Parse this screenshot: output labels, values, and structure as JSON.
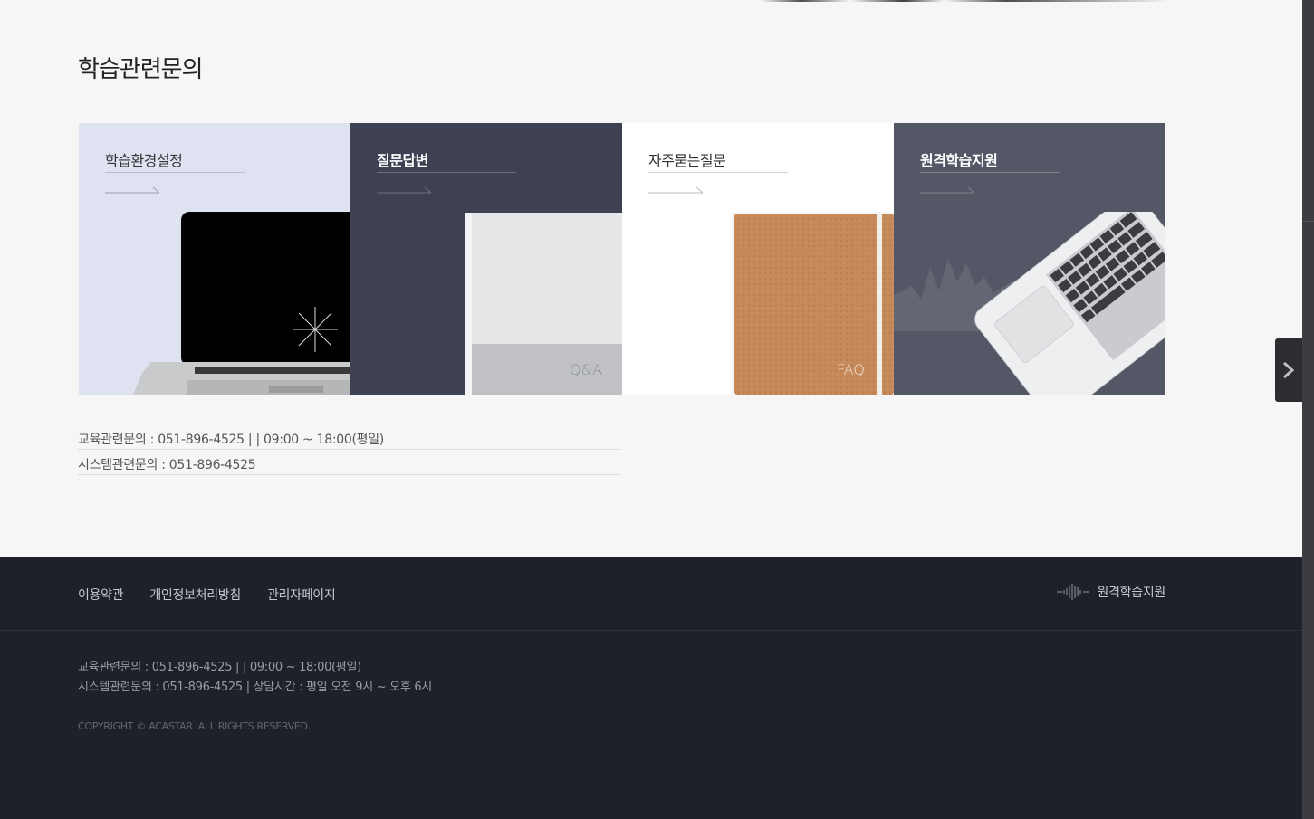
{
  "page": {
    "title": "학습관련문의"
  },
  "cards": [
    {
      "title": "학습환경설정",
      "image": "laptop-image"
    },
    {
      "title": "질문답변",
      "image": "book-image",
      "image_label": "Q&A"
    },
    {
      "title": "자주묻는질문",
      "image": "notebook-image",
      "image_label": "FAQ"
    },
    {
      "title": "원격학습지원",
      "image": "laptop-keyboard-image"
    }
  ],
  "contact": {
    "edu": "교육관련문의 : 051-896-4525  |    |  09:00 ~ 18:00(평일)",
    "system": "시스템관련문의 : 051-896-4525"
  },
  "footer": {
    "nav": [
      "이용약관",
      "개인정보처리방침",
      "관리자페이지"
    ],
    "logo_text": "원격학습지원",
    "info_edu": "교육관련문의 : 051-896-4525  |    |  09:00 ~ 18:00(평일)",
    "info_system": "시스템관련문의 : 051-896-4525  |  상담시간 : 평일 오전 9시 ~ 오후 6시",
    "copyright": "COPYRIGHT © ACASTAR. ALL RIGHTS RESERVED."
  },
  "colors": {
    "background": "#f6f6f6",
    "footer": "#1e2128",
    "card1": "#dfe3f1",
    "card2": "#3d4152",
    "card3": "#ffffff",
    "card4": "#545766"
  },
  "icons": {
    "side_toggle": "chevron-right-icon",
    "footer_logo": "sound-wave-icon"
  }
}
